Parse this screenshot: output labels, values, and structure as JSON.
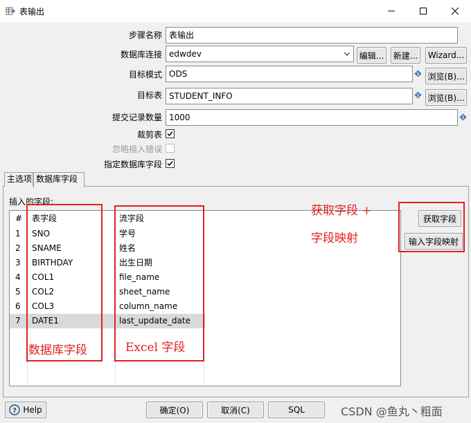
{
  "window": {
    "title": "表输出",
    "icon": "table-output-icon"
  },
  "form": {
    "step_name": {
      "label": "步骤名称",
      "value": "表输出"
    },
    "connection": {
      "label": "数据库连接",
      "value": "edwdev",
      "edit": "编辑...",
      "new": "新建...",
      "wizard": "Wizard..."
    },
    "schema": {
      "label": "目标模式",
      "value": "ODS",
      "browse": "浏览(B)..."
    },
    "table": {
      "label": "目标表",
      "value": "STUDENT_INFO",
      "browse": "浏览(B)..."
    },
    "commit": {
      "label": "提交记录数量",
      "value": "1000"
    },
    "truncate": {
      "label": "裁剪表",
      "checked": true
    },
    "ignore_errors": {
      "label": "忽略插入错误",
      "checked": false
    },
    "specify_fields": {
      "label": "指定数据库字段",
      "checked": true
    }
  },
  "tabs": [
    "主选项",
    "数据库字段"
  ],
  "fields_panel": {
    "label": "插入的字段:",
    "columns": [
      "#",
      "表字段",
      "流字段"
    ],
    "rows": [
      [
        "1",
        "SNO",
        "学号"
      ],
      [
        "2",
        "SNAME",
        "姓名"
      ],
      [
        "3",
        "BIRTHDAY",
        "出生日期"
      ],
      [
        "4",
        "COL1",
        "file_name"
      ],
      [
        "5",
        "COL2",
        "sheet_name"
      ],
      [
        "6",
        "COL3",
        "column_name"
      ],
      [
        "7",
        "DATE1",
        "last_update_date"
      ]
    ],
    "get_fields": "获取字段",
    "enter_mapping": "输入字段映射"
  },
  "annotations": {
    "top": "获取字段 +",
    "mapping": "字段映射",
    "db_fields": "数据库字段",
    "excel_fields": "Excel 字段"
  },
  "footer": {
    "help": "Help",
    "ok": "确定(O)",
    "cancel": "取消(C)",
    "sql": "SQL"
  },
  "watermark": "CSDN @鱼丸丶粗面",
  "colors": {
    "annotation_red": "#e02020",
    "selected_row": "#d9d9d9"
  }
}
